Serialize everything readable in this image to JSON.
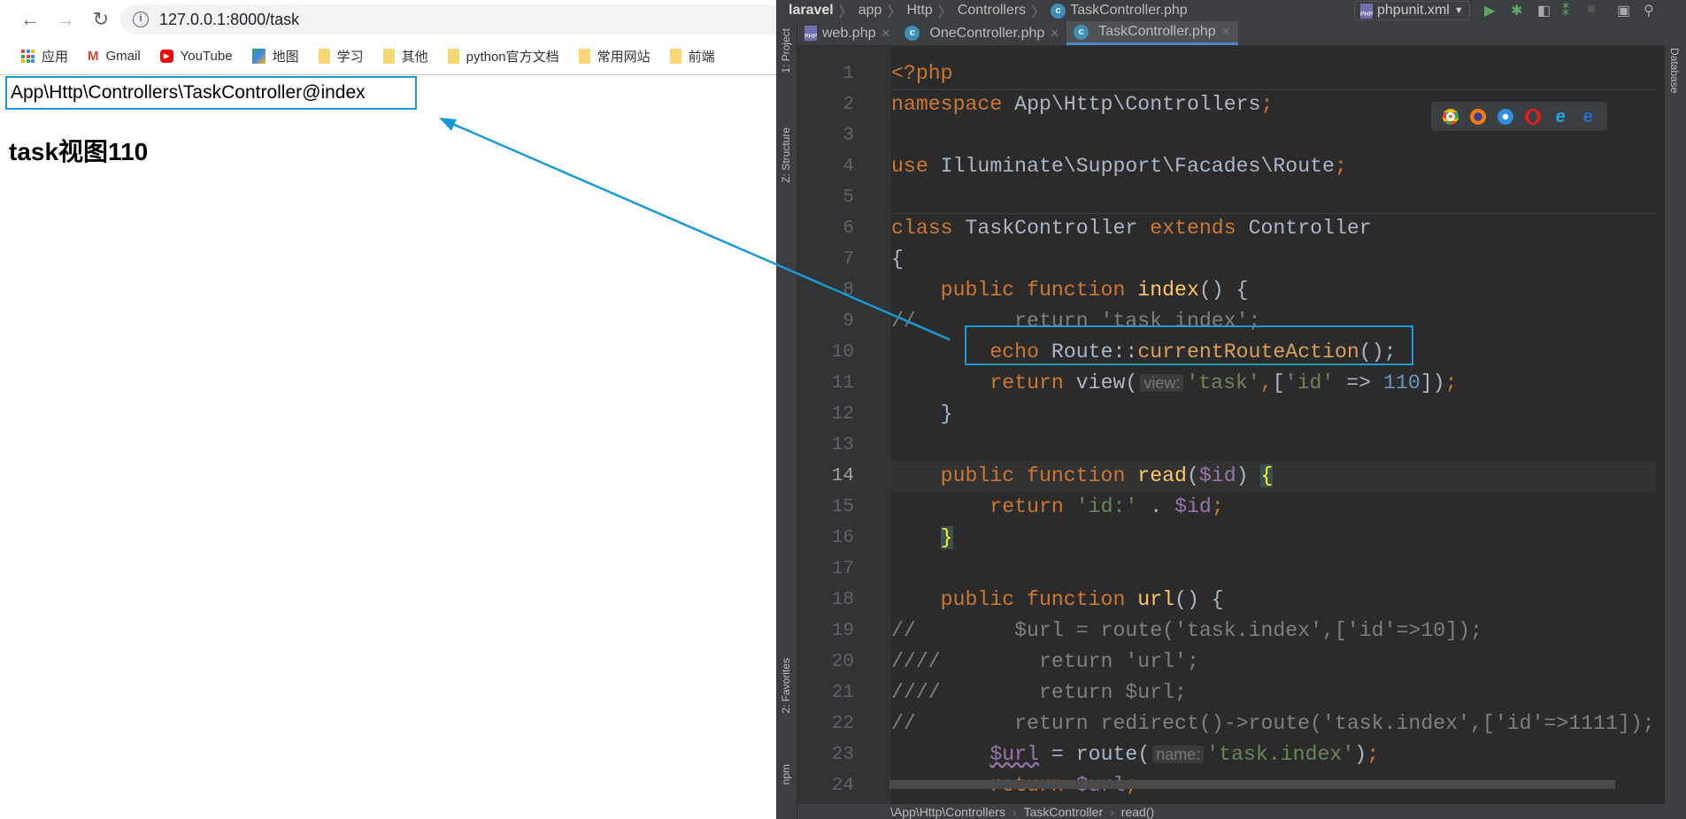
{
  "browser": {
    "url": "127.0.0.1:8000/task",
    "bookmarks": [
      "应用",
      "Gmail",
      "YouTube",
      "地图",
      "学习",
      "其他",
      "python官方文档",
      "常用网站",
      "前端"
    ],
    "output_text": "App\\Http\\Controllers\\TaskController@index",
    "heading": "task视图110"
  },
  "ide": {
    "breadcrumbs": [
      "laravel",
      "app",
      "Http",
      "Controllers",
      "TaskController.php"
    ],
    "run_config": "phpunit.xml",
    "tabs": [
      {
        "label": "web.php",
        "icon": "php-file-icon",
        "active": false
      },
      {
        "label": "OneController.php",
        "icon": "class-icon",
        "active": false
      },
      {
        "label": "TaskController.php",
        "icon": "class-icon",
        "active": true
      }
    ],
    "left_tools": [
      "1: Project",
      "Z: Structure",
      "2: Favorites",
      "npm"
    ],
    "right_tools": [
      "Database"
    ],
    "browser_icons": [
      "chrome",
      "firefox",
      "safari",
      "opera",
      "internet-explorer",
      "edge"
    ],
    "status_breadcrumbs": [
      "\\App\\Http\\Controllers",
      "TaskController",
      "read()"
    ],
    "current_line": 14,
    "lines": [
      [
        [
          "<?php",
          "kw"
        ]
      ],
      [
        [
          "namespace ",
          "kw"
        ],
        [
          "App\\Http\\Controllers",
          "def"
        ],
        [
          ";",
          "kw"
        ]
      ],
      [],
      [
        [
          "use ",
          "kw"
        ],
        [
          "Illuminate\\Support\\Facades\\Route",
          "def"
        ],
        [
          ";",
          "kw"
        ]
      ],
      [],
      [
        [
          "class ",
          "kw"
        ],
        [
          "TaskController ",
          "def"
        ],
        [
          "extends ",
          "kw"
        ],
        [
          "Controller",
          "def"
        ]
      ],
      [
        [
          "{",
          "def"
        ]
      ],
      [
        [
          "    public function ",
          "kw"
        ],
        [
          "index",
          "fn"
        ],
        [
          "() {",
          "def"
        ]
      ],
      [
        [
          "//        return 'task index';",
          "cm"
        ]
      ],
      [
        [
          "        ",
          "def"
        ],
        [
          "echo ",
          "kw"
        ],
        [
          "Route::",
          "def"
        ],
        [
          "currentRouteAction",
          "call"
        ],
        [
          "();",
          "def"
        ]
      ],
      [
        [
          "        ",
          "def"
        ],
        [
          "return ",
          "kw"
        ],
        [
          "view(",
          "def"
        ],
        [
          "view:",
          "hint"
        ],
        [
          "'task'",
          "str"
        ],
        [
          ",",
          "kw"
        ],
        [
          "[",
          "def"
        ],
        [
          "'id'",
          "str"
        ],
        [
          " => ",
          "def"
        ],
        [
          "110",
          "num"
        ],
        [
          "])",
          "def"
        ],
        [
          ";",
          "kw"
        ]
      ],
      [
        [
          "    }",
          "def"
        ]
      ],
      [],
      [
        [
          "    public function ",
          "kw"
        ],
        [
          "read",
          "fn"
        ],
        [
          "(",
          "def"
        ],
        [
          "$id",
          "var"
        ],
        [
          ") ",
          "def"
        ],
        [
          "{",
          "brace"
        ]
      ],
      [
        [
          "        ",
          "def"
        ],
        [
          "return ",
          "kw"
        ],
        [
          "'id:'",
          "str"
        ],
        [
          " . ",
          "def"
        ],
        [
          "$id",
          "var"
        ],
        [
          ";",
          "kw"
        ]
      ],
      [
        [
          "    ",
          "def"
        ],
        [
          "}",
          "brace"
        ]
      ],
      [],
      [
        [
          "    public function ",
          "kw"
        ],
        [
          "url",
          "fn"
        ],
        [
          "() {",
          "def"
        ]
      ],
      [
        [
          "//        $url = route('task.index',['id'=>10]);",
          "cm"
        ]
      ],
      [
        [
          "////        return 'url';",
          "cm"
        ]
      ],
      [
        [
          "////        return $url;",
          "cm"
        ]
      ],
      [
        [
          "//        return redirect()->route('task.index',['id'=>1111]);",
          "cm"
        ]
      ],
      [
        [
          "        ",
          "def"
        ],
        [
          "$url",
          "var wavy"
        ],
        [
          " = route(",
          "def"
        ],
        [
          "name:",
          "hint"
        ],
        [
          "'task.index'",
          "str"
        ],
        [
          ")",
          "def"
        ],
        [
          ";",
          "kw"
        ]
      ],
      [
        [
          "        ",
          "def"
        ],
        [
          "return ",
          "kw"
        ],
        [
          "$url",
          "var"
        ],
        [
          ";",
          "kw"
        ]
      ]
    ]
  }
}
